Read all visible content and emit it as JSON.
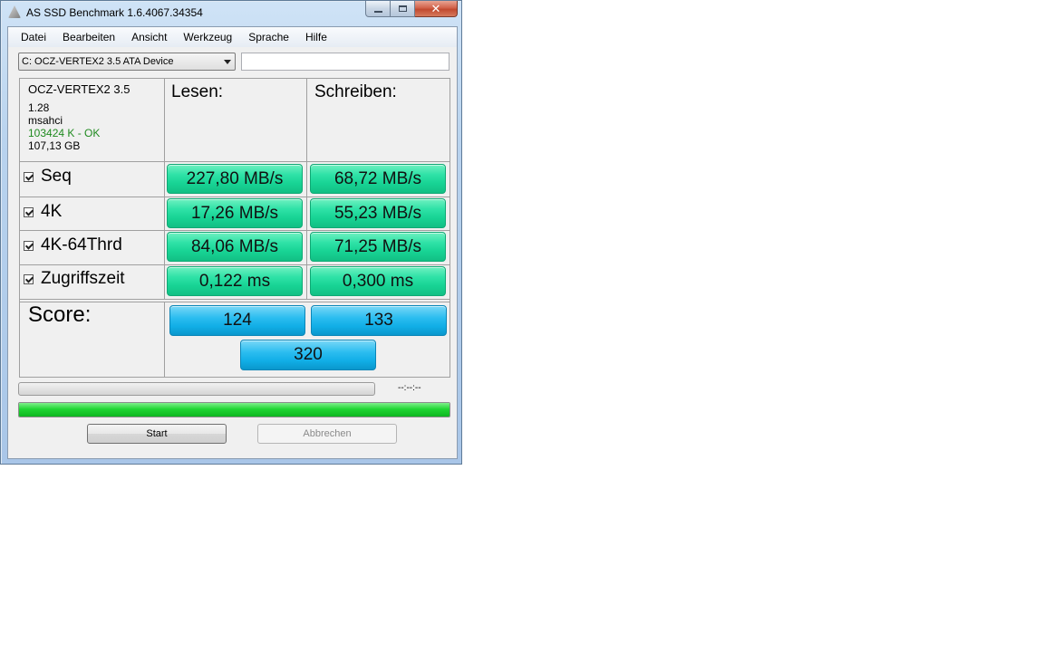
{
  "window": {
    "title": "AS SSD Benchmark 1.6.4067.34354"
  },
  "menu": [
    "Datei",
    "Bearbeiten",
    "Ansicht",
    "Werkzeug",
    "Sprache",
    "Hilfe"
  ],
  "device_select": {
    "value": "C: OCZ-VERTEX2 3.5 ATA Device"
  },
  "info": {
    "name": "OCZ-VERTEX2 3.5",
    "firmware": "1.28",
    "driver": "msahci",
    "alignment": "103424 K - OK",
    "capacity": "107,13 GB"
  },
  "columns": {
    "read": "Lesen:",
    "write": "Schreiben:"
  },
  "rows": [
    {
      "label": "Seq",
      "read": "227,80 MB/s",
      "write": "68,72 MB/s"
    },
    {
      "label": "4K",
      "read": "17,26 MB/s",
      "write": "55,23 MB/s"
    },
    {
      "label": "4K-64Thrd",
      "read": "84,06 MB/s",
      "write": "71,25 MB/s"
    },
    {
      "label": "Zugriffszeit",
      "read": "0,122 ms",
      "write": "0,300 ms"
    }
  ],
  "score": {
    "label": "Score:",
    "read": "124",
    "write": "133",
    "total": "320"
  },
  "progress": {
    "time": "--:--:--",
    "completion_fraction": 1.0
  },
  "buttons": {
    "start": "Start",
    "cancel": "Abbrechen"
  },
  "colors": {
    "value_box": "#2fe2a7",
    "score_box": "#11aee6",
    "progress_fill": "#20d633",
    "ok_text": "#1f8a1f"
  }
}
